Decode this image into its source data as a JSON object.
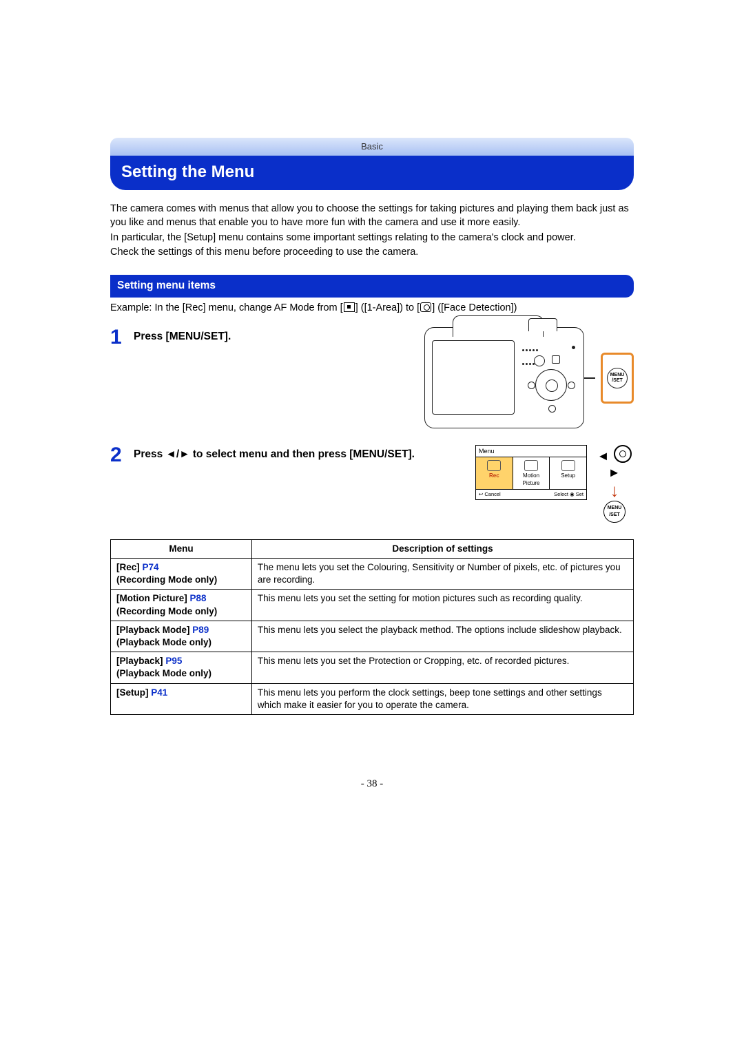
{
  "header_band": "Basic",
  "title": "Setting the Menu",
  "intro": {
    "p1": "The camera comes with menus that allow you to choose the settings for taking pictures and playing them back just as you like and menus that enable you to have more fun with the camera and use it more easily.",
    "p2": "In particular, the [Setup] menu contains some important settings relating to the camera's clock and power.",
    "p3": "Check the settings of this menu before proceeding to use the camera."
  },
  "section_heading": "Setting menu items",
  "example": {
    "prefix": "Example: In the [Rec] menu, change AF Mode from [",
    "mid1": "] ([1-Area]) to [",
    "mid2": "] ([Face Detection])"
  },
  "steps": {
    "s1_num": "1",
    "s1_text": "Press [MENU/SET].",
    "s2_num": "2",
    "s2_text_a": "Press ",
    "s2_arrows": "◄/►",
    "s2_text_b": " to select menu and then press [MENU/SET]."
  },
  "menuset_label_top": "MENU",
  "menuset_label_bottom": "/SET",
  "menu_screen": {
    "title": "Menu",
    "cells": [
      {
        "label": "Rec",
        "active": true
      },
      {
        "label": "Motion Picture",
        "active": false
      },
      {
        "label": "Setup",
        "active": false
      }
    ],
    "footer_left": "↩ Cancel",
    "footer_right": "Select ◉ Set"
  },
  "table": {
    "h1": "Menu",
    "h2": "Description of settings",
    "rows": [
      {
        "name": "[Rec]",
        "page": "P74",
        "note": "(Recording Mode only)",
        "desc": "The menu lets you set the Colouring, Sensitivity or Number of pixels, etc. of pictures you are recording."
      },
      {
        "name": "[Motion Picture]",
        "page": "P88",
        "note": "(Recording Mode only)",
        "desc": "This menu lets you set the setting for motion pictures such as recording quality."
      },
      {
        "name": "[Playback Mode]",
        "page": "P89",
        "note": "(Playback Mode only)",
        "desc": "This menu lets you select the playback method. The options include slideshow playback."
      },
      {
        "name": "[Playback]",
        "page": "P95",
        "note": "(Playback Mode only)",
        "desc": "This menu lets you set the Protection or Cropping, etc. of recorded pictures."
      },
      {
        "name": "[Setup]",
        "page": "P41",
        "note": "",
        "desc": "This menu lets you perform the clock settings, beep tone settings and other settings which make it easier for you to operate the camera."
      }
    ]
  },
  "page_number": "- 38 -"
}
